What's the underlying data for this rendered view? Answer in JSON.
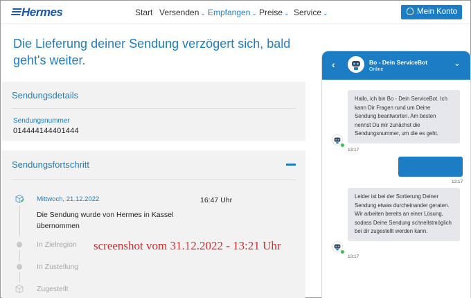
{
  "header": {
    "logo": "Hermes",
    "nav": [
      {
        "label": "Start",
        "dropdown": false,
        "active": false
      },
      {
        "label": "Versenden",
        "dropdown": true,
        "active": false
      },
      {
        "label": "Empfangen",
        "dropdown": true,
        "active": true
      },
      {
        "label": "Preise",
        "dropdown": true,
        "active": false
      },
      {
        "label": "Service",
        "dropdown": true,
        "active": false
      }
    ],
    "account_button": "Mein Konto"
  },
  "main": {
    "headline": "Die Lieferung deiner Sendung verzögert sich, bald geht's weiter.",
    "details": {
      "title": "Sendungsdetails",
      "number_label": "Sendungsnummer",
      "number_value": "014444144401444"
    },
    "progress": {
      "title": "Sendungsfortschritt",
      "current": {
        "date": "Mittwoch, 21.12.2022",
        "time": "16:47 Uhr",
        "description": "Die Sendung wurde von Hermes in Kassel übernommen"
      },
      "pending_steps": [
        "In Zielregion",
        "In Zustellung",
        "Zugestellt"
      ]
    },
    "watermark": "screenshot vom 31.12.2022 - 13:21 Uhr"
  },
  "chat": {
    "bot_name": "Bo - Dein ServiceBot",
    "status": "Online",
    "messages": [
      {
        "from": "bot",
        "text": "Hallo, ich bin Bo - Dein ServiceBot. Ich kann Dir Fragen rund um Deine Sendung beantworten. Am besten nennst Du mir zunächst die Sendungsnummer, um die es geht.",
        "time": "13:17"
      },
      {
        "from": "user",
        "text": "",
        "time": "13:17"
      },
      {
        "from": "bot",
        "text": "Leider ist bei der Sortierung Deiner Sendung etwas durcheinander geraten. Wir arbeiten bereits an einer Lösung, sodass Deine Sendung schnellstmöglich bei dir zugestellt werden kann.",
        "time": "13:17"
      }
    ]
  },
  "colors": {
    "brand_blue": "#1d7dc4",
    "panel_bg": "#f2f2f2",
    "watermark_red": "#d42d2d",
    "online_green": "#3cbf5a"
  }
}
